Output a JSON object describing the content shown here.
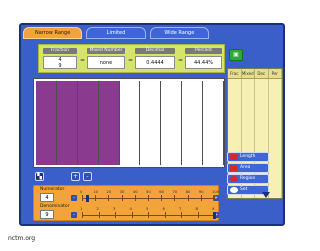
{
  "tabs": [
    "Narrow Range",
    "Limited",
    "Wide Range"
  ],
  "active_tab": "Narrow Range",
  "fields": {
    "fraction": {
      "label": "Fraction",
      "numerator": "4",
      "denominator": "9"
    },
    "mixed": {
      "label": "Mixed Number",
      "value": "none"
    },
    "decimal": {
      "label": "Decimal",
      "value": "0.4444"
    },
    "percent": {
      "label": "Percent",
      "value": "44.44%"
    },
    "equals": "="
  },
  "table": {
    "headers": [
      "Frac",
      "Mixed",
      "Dec",
      "Per"
    ]
  },
  "grid": {
    "cells": 9,
    "filled": 4,
    "fill_color": "#8a3a8f"
  },
  "controls": {
    "plus": "+",
    "minus": "-"
  },
  "numerator": {
    "label": "Numerator",
    "value": "4"
  },
  "denominator": {
    "label": "Denominator",
    "value": "9"
  },
  "numerator_ruler": [
    "0",
    "10",
    "20",
    "30",
    "40",
    "50",
    "60",
    "70",
    "80",
    "90",
    "100"
  ],
  "denominator_ruler": [
    "1",
    "2",
    "3",
    "4",
    "5",
    "6",
    "7",
    "8",
    "9"
  ],
  "modes": [
    "Length",
    "Area",
    "Region",
    "Set"
  ],
  "caption": "nctm.org",
  "colors": {
    "frame": "#3a5fc9",
    "active_tab": "#f2a43a",
    "fill": "#8a3a8f",
    "panel": "#d6e46a"
  }
}
